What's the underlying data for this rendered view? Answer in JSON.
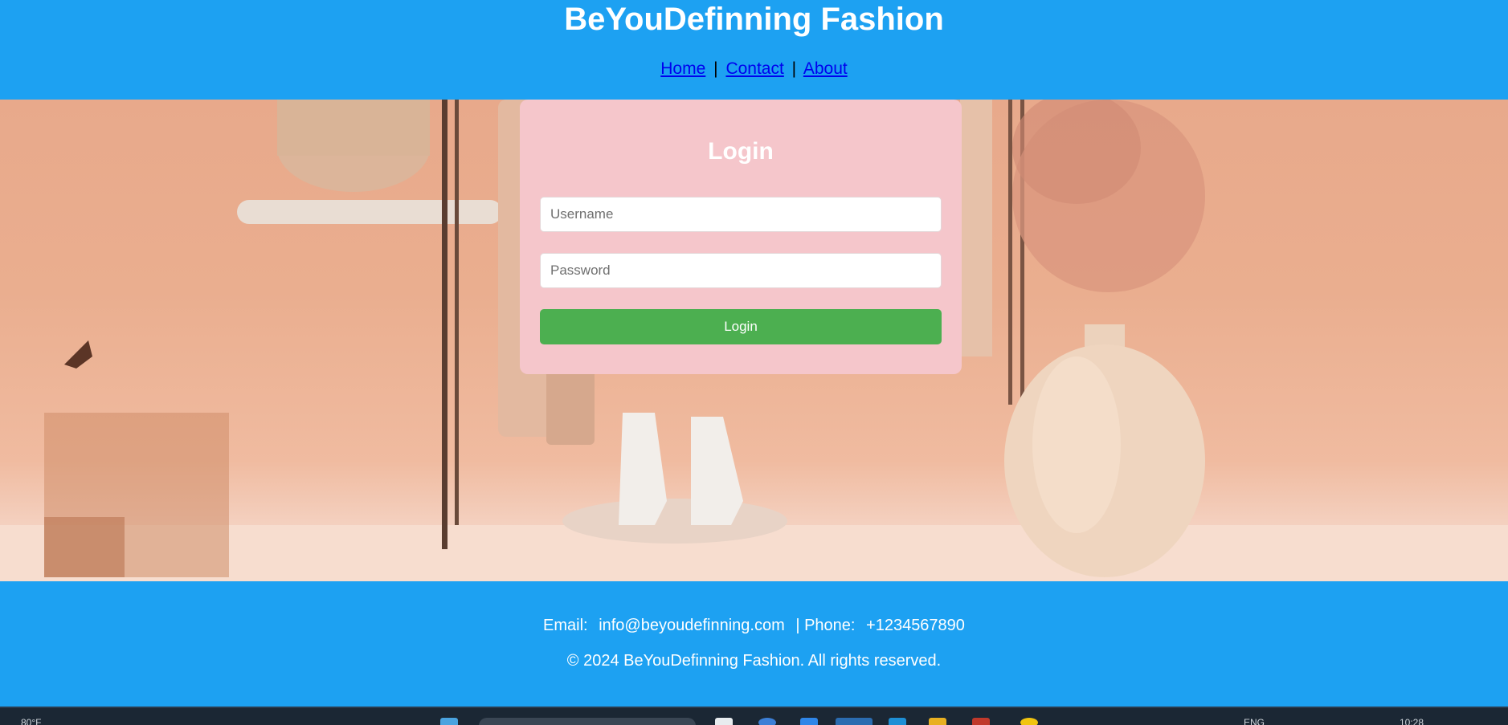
{
  "header": {
    "title": "BeYouDefinning Fashion",
    "nav": [
      {
        "label": "Home"
      },
      {
        "label": "Contact"
      },
      {
        "label": "About"
      }
    ],
    "separator": "|"
  },
  "login": {
    "title": "Login",
    "username_placeholder": "Username",
    "password_placeholder": "Password",
    "button_label": "Login"
  },
  "footer": {
    "email_label": "Email:",
    "email_value": "info@beyoudefinning.com",
    "phone_label": "| Phone:",
    "phone_value": "+1234567890",
    "copyright": "© 2024 BeYouDefinning Fashion. All rights reserved."
  },
  "taskbar": {
    "weather": "80°F",
    "language": "ENG",
    "time": "10:28"
  },
  "colors": {
    "header_bg": "#1DA1F2",
    "card_bg": "#F5C6CB",
    "button_bg": "#4CAF50",
    "link": "#0000EE"
  }
}
